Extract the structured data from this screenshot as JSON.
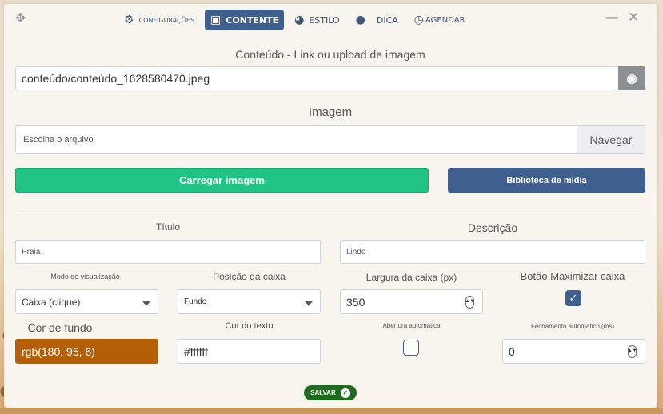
{
  "tabs": [
    {
      "label": "CONFIGURAÇÕES",
      "icon": "gear-icon"
    },
    {
      "label": "CONTENTE",
      "icon": "image-icon"
    },
    {
      "label": "ESTILO",
      "icon": "palette-icon"
    },
    {
      "label": "DICA",
      "icon": "chat-bubble-icon"
    },
    {
      "label": "AGENDAR",
      "icon": "clock-icon"
    }
  ],
  "content": {
    "link_label": "Conteúdo - Link ou upload de imagem",
    "link_value": "conteúdo/conteúdo_1628580470.jpeg",
    "image_label": "Imagem",
    "file_placeholder": "Escolha o arquivo",
    "browse_label": "Navegar",
    "upload_button": "Carregar imagem",
    "media_library_button": "Biblioteca de mídia"
  },
  "form": {
    "title_label": "Título",
    "title_value": "Praia",
    "description_label": "Descrição",
    "description_value": "Lindo",
    "view_mode_label": "Modo de visualização",
    "view_mode_value": "Caixa (clique)",
    "box_position_label": "Posição da caixa",
    "box_position_value": "Fundo",
    "box_width_label": "Largura da caixa (px)",
    "box_width_value": "350",
    "maximize_label": "Botão Maximizar caixa",
    "maximize_checked": true,
    "bg_color_label": "Cor de fundo",
    "bg_color_value": "rgb(180, 95, 6)",
    "text_color_label": "Cor do texto",
    "text_color_value": "#ffffff",
    "auto_open_label": "Abertura automática",
    "auto_open_checked": false,
    "auto_close_label": "Fechamento automático (ms)",
    "auto_close_value": "0"
  },
  "save_button": "SALVAR",
  "colors": {
    "accent": "#3f5f8f",
    "upload_green": "#22c486",
    "bg_color_swatch": "#b45f06",
    "save_green": "#1f6b1f"
  }
}
